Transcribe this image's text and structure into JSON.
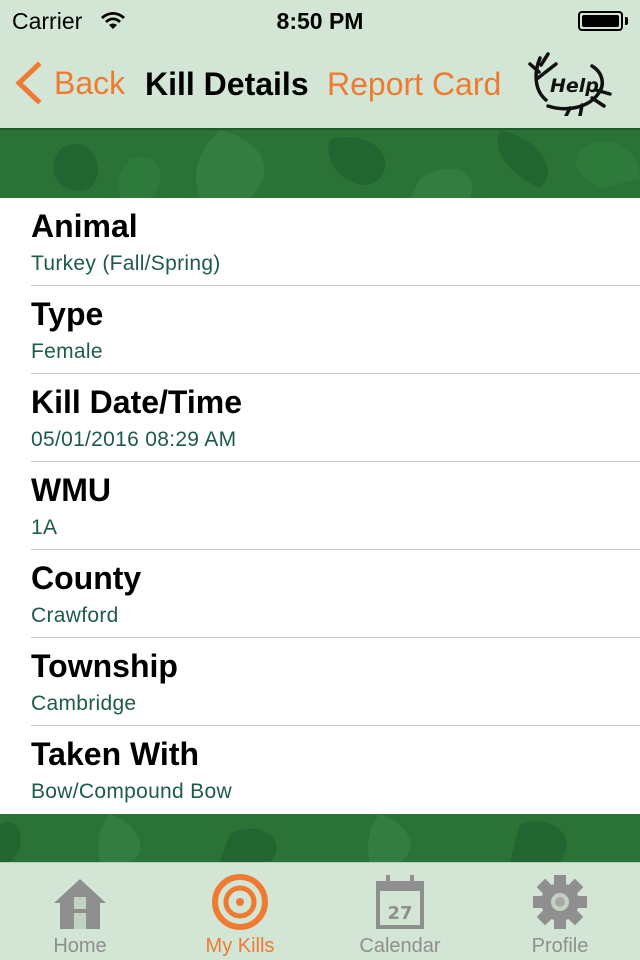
{
  "status_bar": {
    "carrier": "Carrier",
    "time": "8:50 PM"
  },
  "nav": {
    "back_label": "Back",
    "title": "Kill Details",
    "report_card_label": "Report Card",
    "help_label": "Help"
  },
  "details": [
    {
      "label": "Animal",
      "value": "Turkey (Fall/Spring)"
    },
    {
      "label": "Type",
      "value": "Female"
    },
    {
      "label": "Kill Date/Time",
      "value": "05/01/2016 08:29 AM"
    },
    {
      "label": "WMU",
      "value": "1A"
    },
    {
      "label": "County",
      "value": "Crawford"
    },
    {
      "label": "Township",
      "value": "Cambridge"
    },
    {
      "label": "Taken With",
      "value": "Bow/Compound Bow"
    }
  ],
  "tabs": [
    {
      "label": "Home",
      "icon": "home-icon",
      "active": false
    },
    {
      "label": "My Kills",
      "icon": "target-icon",
      "active": true
    },
    {
      "label": "Calendar",
      "icon": "calendar-icon",
      "active": false,
      "calendar_day": "27"
    },
    {
      "label": "Profile",
      "icon": "gear-icon",
      "active": false
    }
  ],
  "colors": {
    "accent": "#ef7a32",
    "value_text": "#1e5c43",
    "bar_background": "#d3e6d5",
    "camo_green": "#276d33",
    "inactive_tab": "#8f8f8f"
  }
}
